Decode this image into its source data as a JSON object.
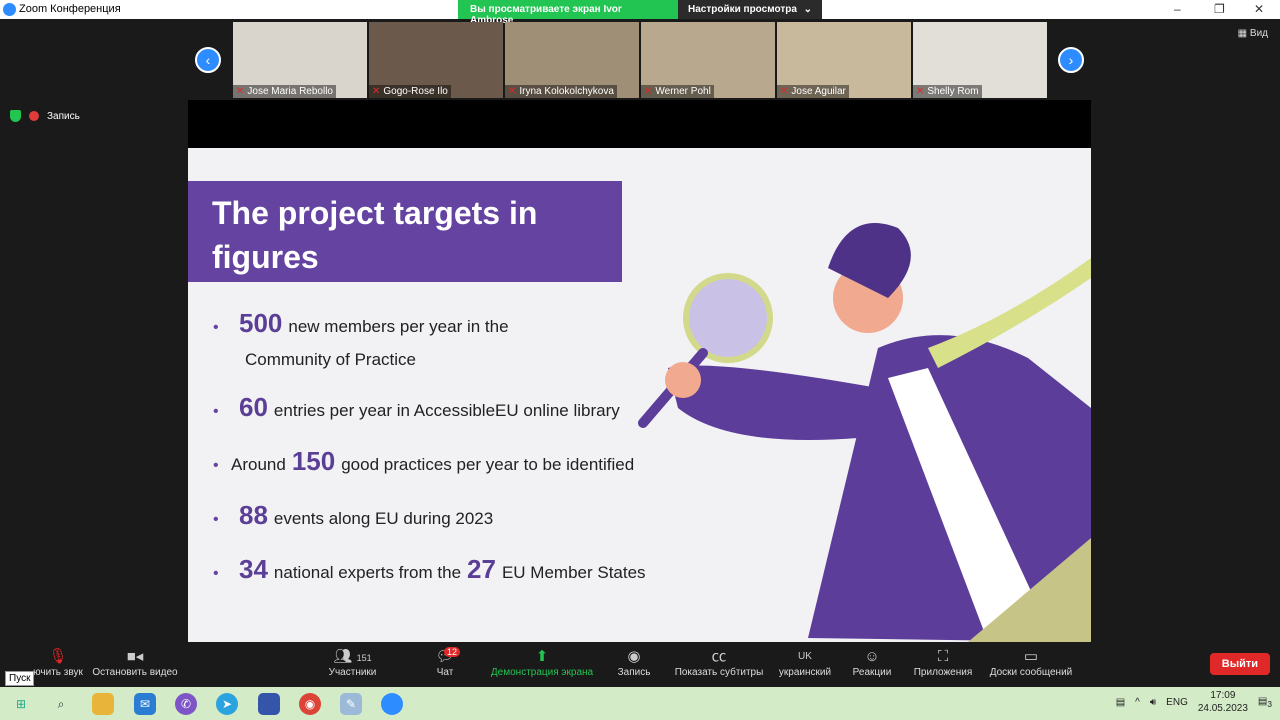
{
  "window": {
    "title": "Zoom Конференция",
    "minimize": "–",
    "maximize": "❐",
    "close": "✕"
  },
  "banner": {
    "viewing": "Вы просматриваете экран Ivor Ambrose",
    "view_options": "Настройки просмотра",
    "chevron": "⌄"
  },
  "participants": [
    {
      "name": "Jose Maria Rebollo",
      "bg": "#d9d4cc"
    },
    {
      "name": "Gogo-Rose Ilo",
      "bg": "#6b5a4b"
    },
    {
      "name": "Iryna Kolokolchykova",
      "bg": "#a08f77"
    },
    {
      "name": "Werner Pohl",
      "bg": "#b8a98e"
    },
    {
      "name": "Jose Aguilar",
      "bg": "#c9b99c"
    },
    {
      "name": "Shelly Rom",
      "bg": "#e2dfd8"
    }
  ],
  "view_label": "Вид",
  "recording_label": "Запись",
  "slide": {
    "title": "The project targets in figures",
    "bullets": [
      {
        "pre": "",
        "num": "500",
        "text": "new members per year in the",
        "cont": "Community of Practice"
      },
      {
        "pre": "",
        "num": "60",
        "text": "entries per year in AccessibleEU online library"
      },
      {
        "pre": "Around",
        "num": "150",
        "text": "good practices per year to be identified"
      },
      {
        "pre": "",
        "num": "88",
        "text": "events along EU during 2023"
      },
      {
        "pre": "",
        "num": "34",
        "text": "national experts from the",
        "num2": "27",
        "text2": "EU Member States"
      }
    ]
  },
  "toolbar": {
    "unmute": "ючить звук",
    "stop_video": "Остановить видео",
    "participants": "Участники",
    "participants_count": "151",
    "chat": "Чат",
    "chat_badge": "12",
    "share": "Демонстрация экрана",
    "record": "Запись",
    "captions": "Показать субтитры",
    "language": "украинский",
    "language_code": "UK",
    "reactions": "Реакции",
    "apps": "Приложения",
    "whiteboards": "Доски сообщений",
    "leave": "Выйти"
  },
  "tooltip": "Пуск",
  "tray": {
    "lang": "ENG",
    "time": "17:09",
    "date": "24.05.2023",
    "notifications": "3"
  }
}
